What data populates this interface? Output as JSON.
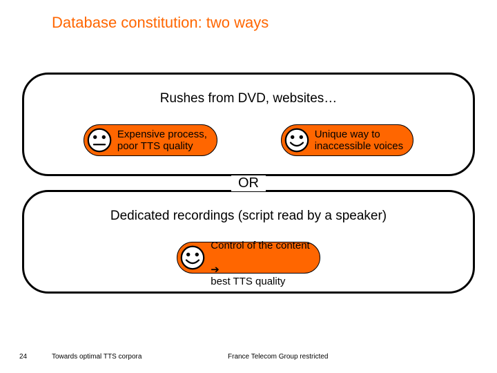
{
  "title": "Database constitution: two ways",
  "or_label": "OR",
  "panel1": {
    "heading": "Rushes from DVD, websites…",
    "pill_left": {
      "face": "neutral",
      "text": "Expensive process,\npoor TTS quality"
    },
    "pill_right": {
      "face": "smile",
      "text": "Unique way to\ninaccessible voices"
    }
  },
  "panel2": {
    "heading": "Dedicated recordings (script read by a speaker)",
    "pill": {
      "face": "smile",
      "text_line1": "Control of the content",
      "text_line2": "best TTS quality",
      "arrow": "➔"
    }
  },
  "footer": {
    "page": "24",
    "left": "Towards optimal TTS corpora",
    "right": "France Telecom Group restricted"
  }
}
